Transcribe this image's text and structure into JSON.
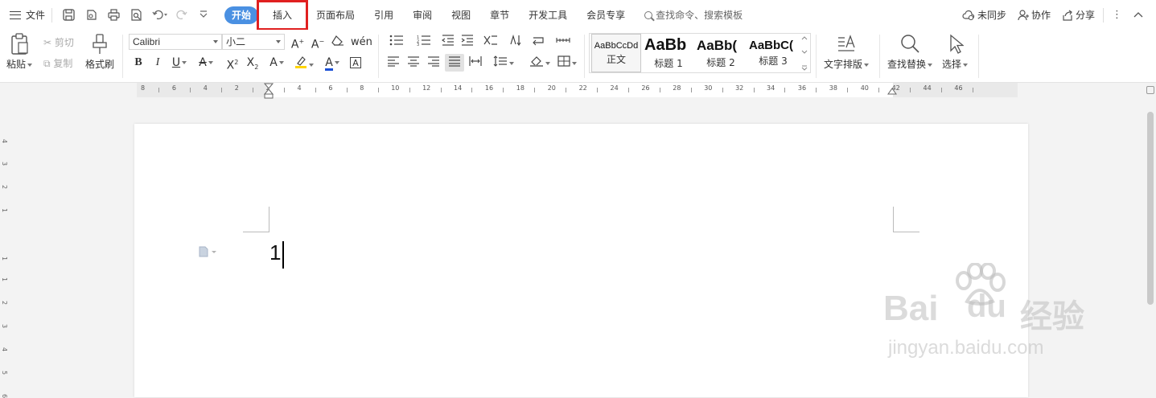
{
  "menubar": {
    "file_label": "文件",
    "tabs": [
      {
        "label": "开始",
        "state": "active"
      },
      {
        "label": "插入",
        "state": "highlighted"
      },
      {
        "label": "页面布局",
        "state": "normal"
      },
      {
        "label": "引用",
        "state": "normal"
      },
      {
        "label": "审阅",
        "state": "normal"
      },
      {
        "label": "视图",
        "state": "normal"
      },
      {
        "label": "章节",
        "state": "normal"
      },
      {
        "label": "开发工具",
        "state": "normal"
      },
      {
        "label": "会员专享",
        "state": "normal"
      }
    ],
    "search_placeholder": "查找命令、搜索模板",
    "sync_label": "未同步",
    "collab_label": "协作",
    "share_label": "分享",
    "highlight_color": "#e02020",
    "active_tab_color": "#4a90e2"
  },
  "ribbon": {
    "paste_label": "粘贴",
    "cut_label": "剪切",
    "copy_label": "复制",
    "format_painter_label": "格式刷",
    "font_name": "Calibri",
    "font_size": "小二",
    "styles": [
      {
        "preview": "AaBbCcDd",
        "name": "正文"
      },
      {
        "preview": "AaBb",
        "name": "标题 1"
      },
      {
        "preview": "AaBb(",
        "name": "标题 2"
      },
      {
        "preview": "AaBbC(",
        "name": "标题 3"
      }
    ],
    "text_layout_label": "文字排版",
    "find_replace_label": "查找替换",
    "select_label": "选择"
  },
  "ruler": {
    "numbers": [
      "8",
      "6",
      "4",
      "2",
      "2",
      "4",
      "6",
      "8",
      "10",
      "12",
      "14",
      "16",
      "18",
      "20",
      "22",
      "24",
      "26",
      "28",
      "30",
      "32",
      "34",
      "36",
      "38",
      "40",
      "42",
      "44",
      "46"
    ],
    "vertical_numbers": [
      "4",
      "3",
      "2",
      "1",
      "1",
      "1",
      "2",
      "3",
      "4",
      "5",
      "6"
    ]
  },
  "document": {
    "text": "1"
  },
  "watermark": {
    "brand": "Bai",
    "brand_du": "du",
    "product": "经验",
    "url": "jingyan.baidu.com"
  }
}
